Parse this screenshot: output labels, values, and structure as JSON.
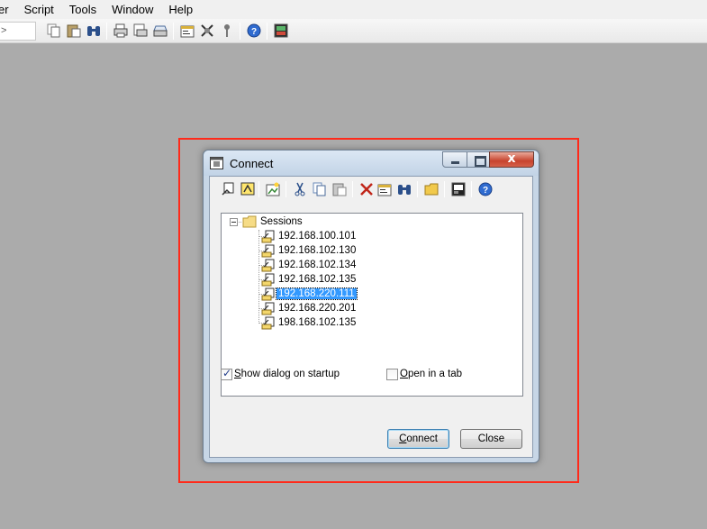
{
  "menubar": {
    "items": [
      "er",
      "Script",
      "Tools",
      "Window",
      "Help"
    ]
  },
  "toolbar": {
    "address_text": ">",
    "icons": [
      "copy-icon",
      "paste-icon",
      "find-icon",
      "print-icon",
      "print-setup-icon",
      "print-screen-icon",
      "session-options-icon",
      "global-options-icon",
      "keymap-icon",
      "help-icon",
      "sftp-icon"
    ]
  },
  "dialog": {
    "title": "Connect",
    "close_glyph": "x",
    "toolbar_icons": [
      "quick-connect-icon",
      "connect-icon",
      "new-session-icon",
      "cut-icon",
      "copy-icon",
      "paste-icon",
      "delete-icon",
      "properties-icon",
      "find-icon",
      "new-folder-icon",
      "terminal-icon",
      "help-icon"
    ],
    "tree": {
      "root_label": "Sessions",
      "sessions": [
        "192.168.100.101",
        "192.168.102.130",
        "192.168.102.134",
        "192.168.102.135",
        "192.168.220.111",
        "192.168.220.201",
        "198.168.102.135"
      ],
      "selected_index": 4
    },
    "show_dialog_on_startup": {
      "label": "Show dialog on startup",
      "checked": true
    },
    "open_in_tab": {
      "label": "Open in a tab",
      "checked": false
    },
    "connect_label": "Connect",
    "close_label": "Close"
  },
  "colors": {
    "desktop": "#ababab",
    "highlight": "#ff2a1a",
    "selection": "#3399ff"
  }
}
